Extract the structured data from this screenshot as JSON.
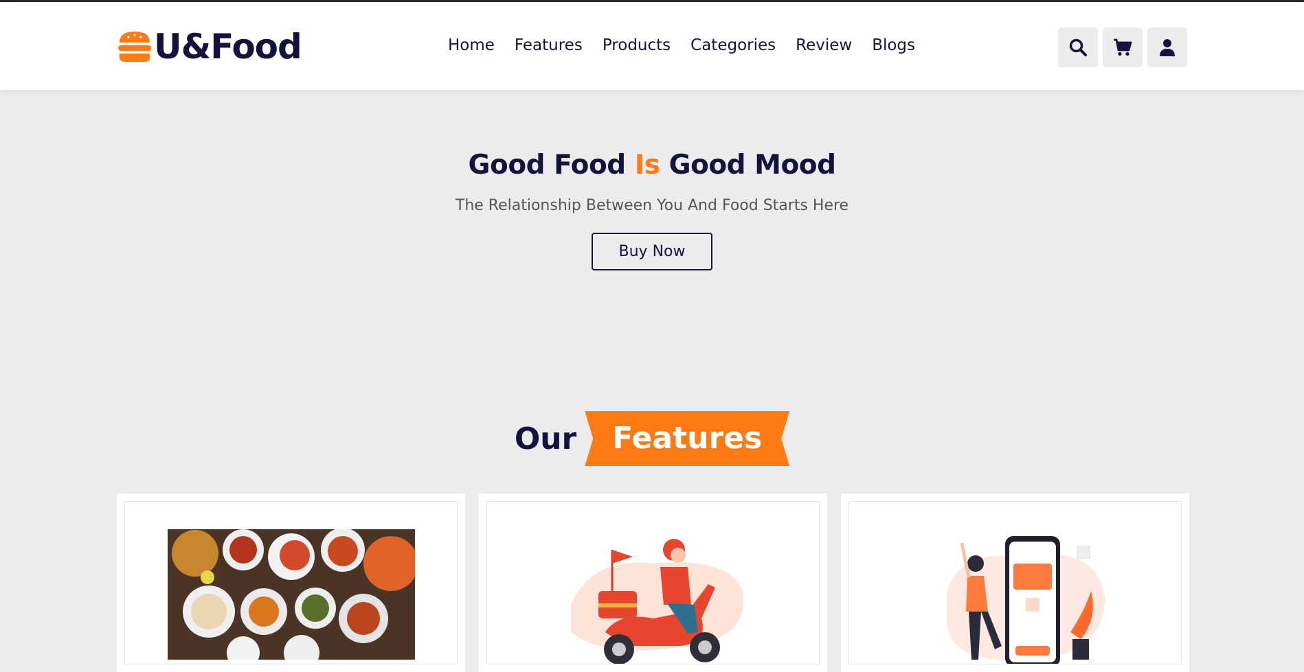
{
  "header": {
    "logo_text": "U&Food",
    "logo_icon": "burger-icon",
    "nav": [
      {
        "label": "Home"
      },
      {
        "label": "Features"
      },
      {
        "label": "Products"
      },
      {
        "label": "Categories"
      },
      {
        "label": "Review"
      },
      {
        "label": "Blogs"
      }
    ],
    "icons": [
      "search-icon",
      "cart-icon",
      "user-icon"
    ]
  },
  "hero": {
    "title_part1": "Good Food ",
    "title_accent": "Is",
    "title_part2": " Good Mood",
    "subtitle": "The Relationship Between You And Food Starts Here",
    "button_label": "Buy Now"
  },
  "features": {
    "heading_plain": "Our",
    "heading_ribbon": "Features",
    "cards": [
      {
        "image": "food-dishes-photo"
      },
      {
        "image": "delivery-scooter-illustration"
      },
      {
        "image": "mobile-payment-illustration"
      }
    ]
  },
  "colors": {
    "accent": "#ff7a12",
    "navy": "#13133d",
    "background": "#ececec"
  }
}
